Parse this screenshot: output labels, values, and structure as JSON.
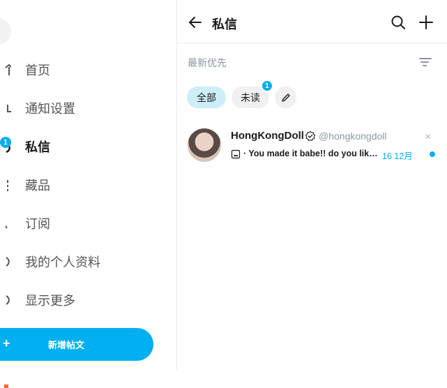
{
  "sidebar": {
    "items": [
      {
        "label": "首页"
      },
      {
        "label": "通知设置"
      },
      {
        "label": "私信",
        "badge": "1"
      },
      {
        "label": "藏品"
      },
      {
        "label": "订阅"
      },
      {
        "label": "我的个人资料"
      },
      {
        "label": "显示更多"
      }
    ],
    "new_post_label": "新增帖文"
  },
  "header": {
    "title": "私信"
  },
  "sort": {
    "label": "最新优先"
  },
  "filters": {
    "all_label": "全部",
    "unread_label": "未读",
    "unread_badge": "1"
  },
  "chats": [
    {
      "name": "HongKongDoll",
      "handle": "@hongkongdoll",
      "preview": "· You made it babe!! do you like it?",
      "date": "16 12月",
      "close": "×"
    }
  ],
  "colors": {
    "accent": "#00aff0",
    "active_filter_bg": "#cdeef9",
    "muted_text": "#8a96a3"
  },
  "icons": {
    "back": "arrow-left-icon",
    "search": "search-icon",
    "add": "plus-icon",
    "sort": "sort-icon",
    "edit": "pencil-icon",
    "verified": "verified-badge-icon",
    "media": "image-icon"
  }
}
